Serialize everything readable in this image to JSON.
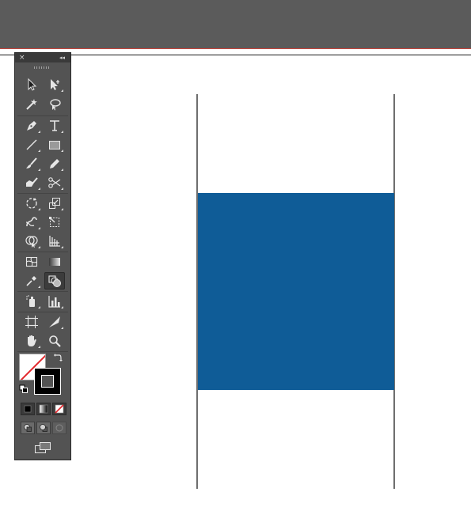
{
  "app": {
    "accent_colors": {
      "top_bar": "#5b5b5b",
      "guide_line": "#c1443d",
      "panel_bg": "#535353",
      "shape_fill": "#0f5c97"
    }
  },
  "tools_panel": {
    "close_glyph": "×",
    "collapse_glyph": "◂◂",
    "tools": [
      {
        "name": "selection-tool",
        "icon": "arrow-icon",
        "has_flyout": false
      },
      {
        "name": "direct-selection-tool",
        "icon": "direct-arrow-icon",
        "has_flyout": true
      },
      {
        "name": "magic-wand-tool",
        "icon": "magic-wand-icon",
        "has_flyout": false
      },
      {
        "name": "lasso-tool",
        "icon": "lasso-icon",
        "has_flyout": false
      },
      {
        "name": "pen-tool",
        "icon": "pen-icon",
        "has_flyout": true
      },
      {
        "name": "type-tool",
        "icon": "type-icon",
        "has_flyout": true
      },
      {
        "name": "line-tool",
        "icon": "line-icon",
        "has_flyout": true
      },
      {
        "name": "rectangle-tool",
        "icon": "rectangle-icon",
        "has_flyout": true
      },
      {
        "name": "paintbrush-tool",
        "icon": "brush-icon",
        "has_flyout": true
      },
      {
        "name": "pencil-tool",
        "icon": "pencil-icon",
        "has_flyout": true
      },
      {
        "name": "blob-brush-tool",
        "icon": "blob-brush-icon",
        "has_flyout": true
      },
      {
        "name": "scissors-tool",
        "icon": "scissors-icon",
        "has_flyout": true
      },
      {
        "name": "rotate-tool",
        "icon": "rotate-icon",
        "has_flyout": true
      },
      {
        "name": "scale-tool",
        "icon": "scale-icon",
        "has_flyout": true
      },
      {
        "name": "warp-tool",
        "icon": "warp-icon",
        "has_flyout": true
      },
      {
        "name": "free-transform-tool",
        "icon": "free-transform-icon",
        "has_flyout": false
      },
      {
        "name": "shape-builder-tool",
        "icon": "shape-builder-icon",
        "has_flyout": true
      },
      {
        "name": "perspective-grid-tool",
        "icon": "perspective-grid-icon",
        "has_flyout": true
      },
      {
        "name": "mesh-tool",
        "icon": "mesh-icon",
        "has_flyout": false
      },
      {
        "name": "gradient-tool",
        "icon": "gradient-icon",
        "has_flyout": false
      },
      {
        "name": "eyedropper-tool",
        "icon": "eyedropper-icon",
        "has_flyout": true
      },
      {
        "name": "blend-tool",
        "icon": "blend-icon",
        "has_flyout": false,
        "active": true
      },
      {
        "name": "symbol-sprayer-tool",
        "icon": "symbol-sprayer-icon",
        "has_flyout": true
      },
      {
        "name": "column-graph-tool",
        "icon": "column-graph-icon",
        "has_flyout": true
      },
      {
        "name": "artboard-tool",
        "icon": "artboard-icon",
        "has_flyout": false
      },
      {
        "name": "slice-tool",
        "icon": "slice-icon",
        "has_flyout": true
      },
      {
        "name": "hand-tool",
        "icon": "hand-icon",
        "has_flyout": true
      },
      {
        "name": "zoom-tool",
        "icon": "zoom-icon",
        "has_flyout": false
      }
    ],
    "fill": {
      "color": "none"
    },
    "stroke": {
      "color": "#000000"
    },
    "color_modes": [
      "color",
      "gradient",
      "none"
    ],
    "draw_modes": [
      "draw-normal",
      "draw-behind",
      "draw-inside"
    ]
  },
  "canvas": {
    "shape": {
      "type": "rectangle",
      "fill": "#0f5c97"
    }
  }
}
